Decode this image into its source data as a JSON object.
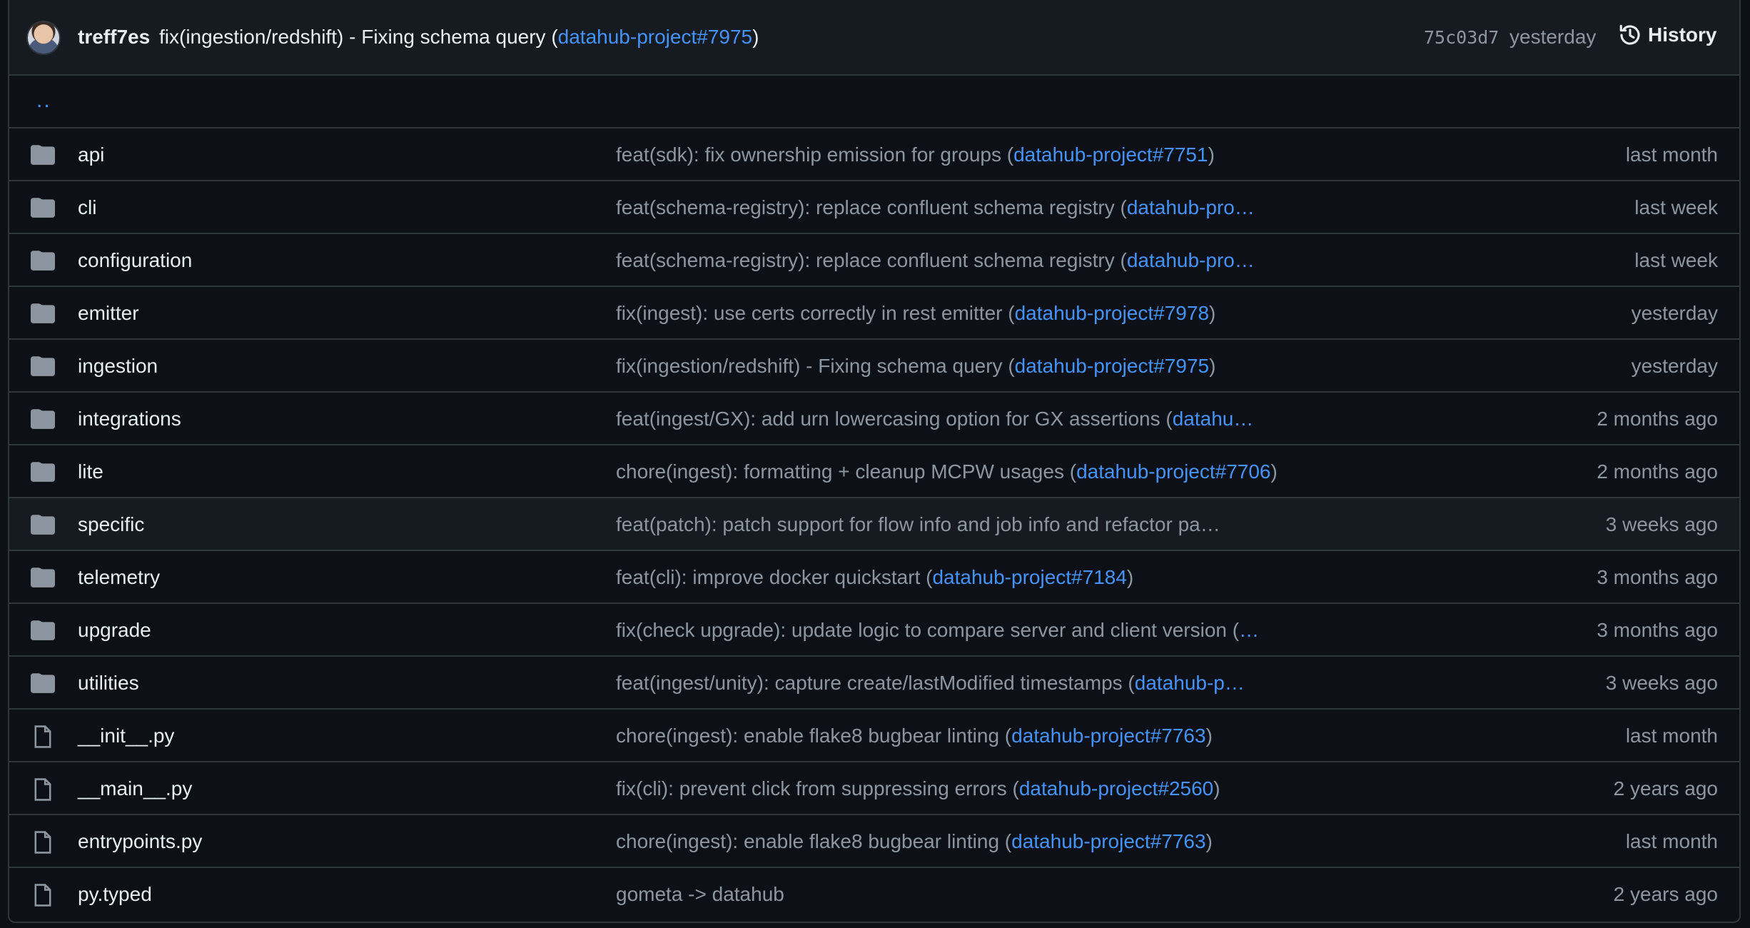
{
  "header": {
    "author": "treff7es",
    "message": "fix(ingestion/redshift) - Fixing schema query (",
    "message_link": "datahub-project#7975",
    "message_end": ")",
    "sha": "75c03d7",
    "time": "yesterday",
    "history_label": "History"
  },
  "parent_dir": "..",
  "rows": [
    {
      "type": "folder",
      "name": "api",
      "msg": "feat(sdk): fix ownership emission for groups (",
      "link": "datahub-project#7751",
      "end": ")",
      "time": "last month"
    },
    {
      "type": "folder",
      "name": "cli",
      "msg": "feat(schema-registry): replace confluent schema registry (",
      "link": "datahub-pro…",
      "end": "",
      "time": "last week"
    },
    {
      "type": "folder",
      "name": "configuration",
      "msg": "feat(schema-registry): replace confluent schema registry (",
      "link": "datahub-pro…",
      "end": "",
      "time": "last week"
    },
    {
      "type": "folder",
      "name": "emitter",
      "msg": "fix(ingest): use certs correctly in rest emitter (",
      "link": "datahub-project#7978",
      "end": ")",
      "time": "yesterday"
    },
    {
      "type": "folder",
      "name": "ingestion",
      "msg": "fix(ingestion/redshift) - Fixing schema query (",
      "link": "datahub-project#7975",
      "end": ")",
      "time": "yesterday"
    },
    {
      "type": "folder",
      "name": "integrations",
      "msg": "feat(ingest/GX): add urn lowercasing option for GX assertions (",
      "link": "datahu…",
      "end": "",
      "time": "2 months ago"
    },
    {
      "type": "folder",
      "name": "lite",
      "msg": "chore(ingest): formatting + cleanup MCPW usages (",
      "link": "datahub-project#7706",
      "end": ")",
      "time": "2 months ago"
    },
    {
      "type": "folder",
      "name": "specific",
      "msg": "feat(patch): patch support for flow info and job info and refactor pa…",
      "link": "",
      "end": "",
      "time": "3 weeks ago"
    },
    {
      "type": "folder",
      "name": "telemetry",
      "msg": "feat(cli): improve docker quickstart (",
      "link": "datahub-project#7184",
      "end": ")",
      "time": "3 months ago"
    },
    {
      "type": "folder",
      "name": "upgrade",
      "msg": "fix(check upgrade): update logic to compare server and client version (",
      "link": "…",
      "end": "",
      "time": "3 months ago"
    },
    {
      "type": "folder",
      "name": "utilities",
      "msg": "feat(ingest/unity): capture create/lastModified timestamps (",
      "link": "datahub-p…",
      "end": "",
      "time": "3 weeks ago"
    },
    {
      "type": "file",
      "name": "__init__.py",
      "msg": "chore(ingest): enable flake8 bugbear linting (",
      "link": "datahub-project#7763",
      "end": ")",
      "time": "last month"
    },
    {
      "type": "file",
      "name": "__main__.py",
      "msg": "fix(cli): prevent click from suppressing errors (",
      "link": "datahub-project#2560",
      "end": ")",
      "time": "2 years ago"
    },
    {
      "type": "file",
      "name": "entrypoints.py",
      "msg": "chore(ingest): enable flake8 bugbear linting (",
      "link": "datahub-project#7763",
      "end": ")",
      "time": "last month"
    },
    {
      "type": "file",
      "name": "py.typed",
      "msg": "gometa -> datahub",
      "link": "",
      "end": "",
      "time": "2 years ago"
    }
  ],
  "colors": {
    "background": "#0d1117",
    "header_bg": "#161b22",
    "border": "#30363d",
    "link": "#4493f8",
    "muted": "#8d96a0",
    "text": "#e6edf3"
  }
}
